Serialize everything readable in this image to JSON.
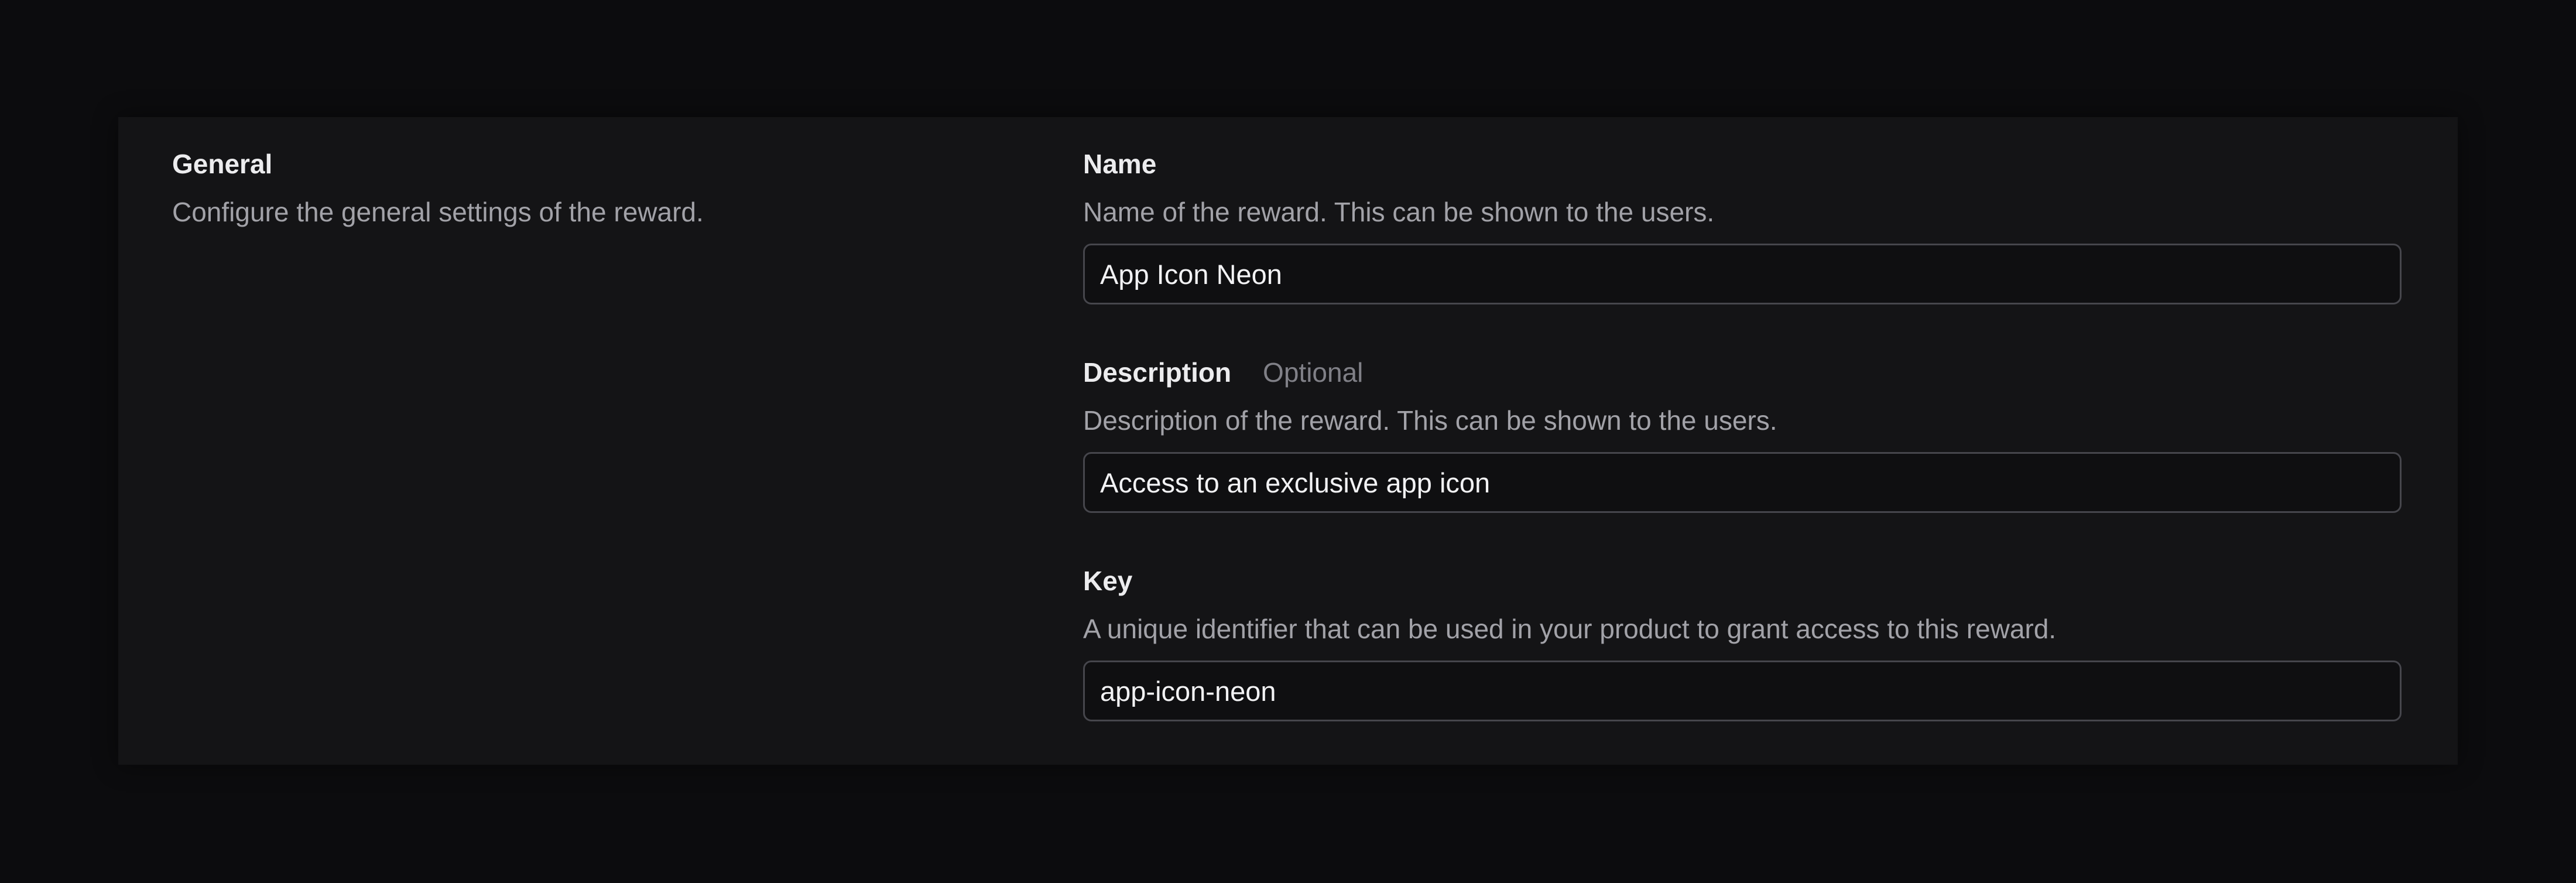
{
  "section": {
    "title": "General",
    "description": "Configure the general settings of the reward."
  },
  "fields": {
    "name": {
      "label": "Name",
      "description": "Name of the reward. This can be shown to the users.",
      "value": "App Icon Neon"
    },
    "description": {
      "label": "Description",
      "optional": "Optional",
      "description": "Description of the reward. This can be shown to the users.",
      "value": "Access to an exclusive app icon"
    },
    "key": {
      "label": "Key",
      "description": "A unique identifier that can be used in your product to grant access to this reward.",
      "value": "app-icon-neon"
    }
  },
  "colors": {
    "page_background": "#0c0c0e",
    "card_background": "#141416",
    "input_border": "#46464c",
    "text_primary": "#ececee",
    "text_secondary": "#a2a2a8",
    "text_muted": "#808087"
  }
}
